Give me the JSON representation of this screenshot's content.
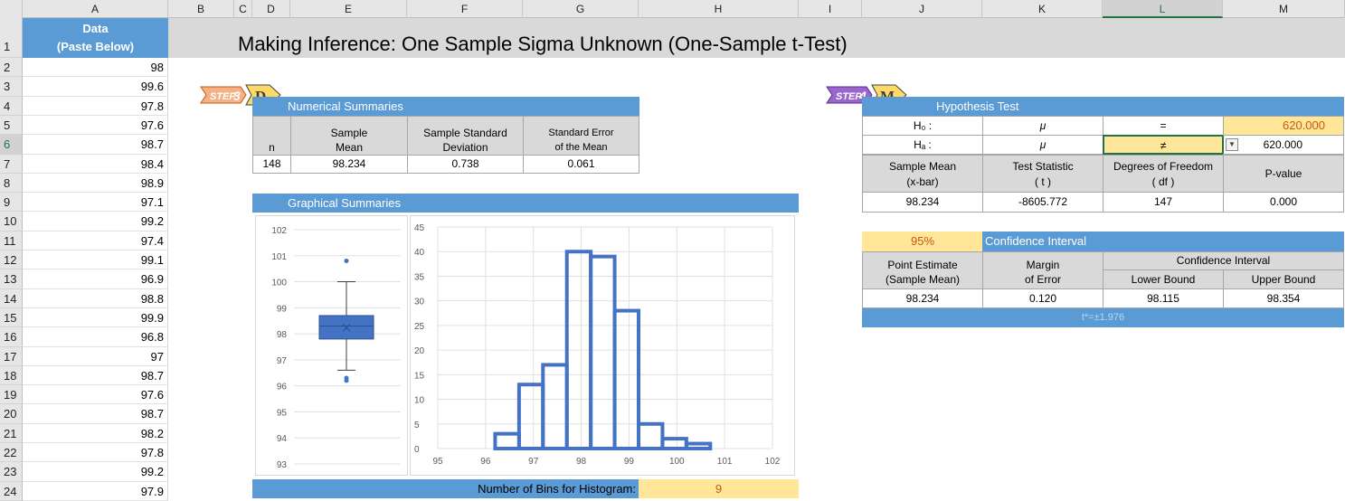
{
  "columns": [
    "A",
    "B",
    "C",
    "D",
    "E",
    "F",
    "G",
    "H",
    "I",
    "J",
    "K",
    "L",
    "M"
  ],
  "rows": [
    "1",
    "2",
    "3",
    "4",
    "5",
    "6",
    "7",
    "8",
    "9",
    "10",
    "11",
    "12",
    "13",
    "14",
    "15",
    "16",
    "17",
    "18",
    "19",
    "20",
    "21",
    "22",
    "23",
    "24"
  ],
  "data_header": {
    "line1": "Data",
    "line2": "(Paste Below)"
  },
  "data_values": [
    "98",
    "99.6",
    "97.8",
    "97.6",
    "98.7",
    "98.4",
    "98.9",
    "97.1",
    "99.2",
    "97.4",
    "99.1",
    "96.9",
    "98.8",
    "99.9",
    "96.8",
    "97",
    "98.7",
    "97.6",
    "98.7",
    "98.2",
    "97.8",
    "99.2",
    "97.9"
  ],
  "title": "Making Inference: One Sample Sigma Unknown (One-Sample t-Test)",
  "step3": {
    "label": "STEP 3"
  },
  "step4": {
    "label": "STEP 4"
  },
  "numerical": {
    "header": "Numerical Summaries",
    "col_n": "n",
    "col_mean": [
      "Sample",
      "Mean"
    ],
    "col_sd": [
      "Sample Standard",
      "Deviation"
    ],
    "col_se": [
      "Standard Error",
      "of the Mean"
    ],
    "n": "148",
    "mean": "98.234",
    "sd": "0.738",
    "se": "0.061"
  },
  "graphical": {
    "header": "Graphical Summaries",
    "bins_label": "Number of Bins for Histogram:",
    "bins_value": "9"
  },
  "hypothesis": {
    "header": "Hypothesis Test",
    "h0": "H₀ :",
    "ha": "Hₐ :",
    "mu": "μ",
    "eq": "=",
    "ne": "≠",
    "h0_value": "620.000",
    "ha_value": "620.000",
    "col1": [
      "Sample Mean",
      "(x-bar)"
    ],
    "col2": [
      "Test Statistic",
      "( t )"
    ],
    "col3": [
      "Degrees of Freedom",
      "( df )"
    ],
    "col4": "P-value",
    "mean": "98.234",
    "t": "-8605.772",
    "df": "147",
    "p": "0.000"
  },
  "confidence": {
    "level": "95%",
    "header": "Confidence Interval",
    "col1": [
      "Point Estimate",
      "(Sample Mean)"
    ],
    "col2": [
      "Margin",
      "of Error"
    ],
    "col3": "Confidence Interval",
    "lower_label": "Lower Bound",
    "upper_label": "Upper Bound",
    "point": "98.234",
    "margin": "0.120",
    "lower": "98.115",
    "upper": "98.354",
    "tstar": "t*=±1.976"
  },
  "chart_data": [
    {
      "type": "box",
      "ylim": [
        93,
        102
      ],
      "yticks": [
        "93",
        "94",
        "95",
        "96",
        "97",
        "98",
        "99",
        "100",
        "101",
        "102"
      ],
      "q1": 97.8,
      "median": 98.3,
      "q3": 98.7,
      "mean": 98.234,
      "whisker_low": 96.6,
      "whisker_high": 100.0,
      "outliers": [
        96.3,
        96.2,
        100.8
      ],
      "color": "#4472c4"
    },
    {
      "type": "bar",
      "xlim": [
        95,
        102
      ],
      "ylim": [
        0,
        45
      ],
      "xticks": [
        "95",
        "96",
        "97",
        "98",
        "99",
        "100",
        "101",
        "102"
      ],
      "yticks": [
        "0",
        "5",
        "10",
        "15",
        "20",
        "25",
        "30",
        "35",
        "40",
        "45"
      ],
      "bins": [
        [
          96.2,
          96.7
        ],
        [
          96.7,
          97.2
        ],
        [
          97.2,
          97.7
        ],
        [
          97.7,
          98.2
        ],
        [
          98.2,
          98.7
        ],
        [
          98.7,
          99.2
        ],
        [
          99.2,
          99.7
        ],
        [
          99.7,
          100.2
        ],
        [
          100.2,
          100.7
        ]
      ],
      "values": [
        3,
        13,
        17,
        40,
        39,
        28,
        5,
        2,
        1
      ],
      "color": "#4472c4"
    }
  ]
}
